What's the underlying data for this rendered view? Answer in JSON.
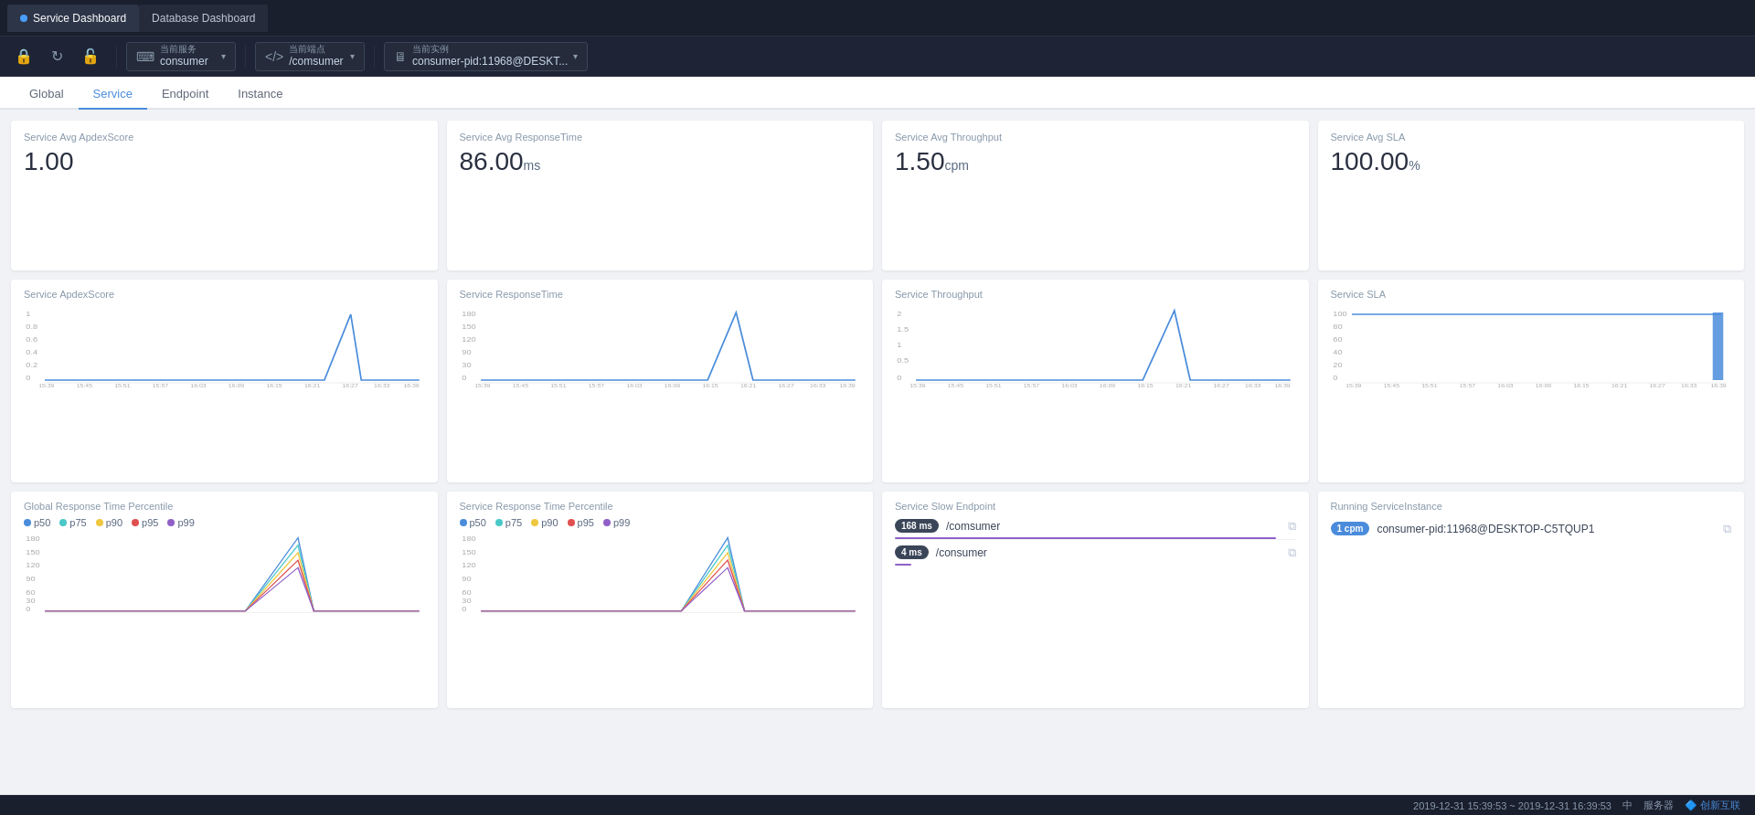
{
  "app": {
    "title": "Service Dashboard",
    "tab1": "Service Dashboard",
    "tab2": "Database Dashboard"
  },
  "toolbar": {
    "current_service_label": "当前服务",
    "current_service_value": "consumer",
    "current_endpoint_label": "当前端点",
    "current_endpoint_value": "/comsumer",
    "current_instance_label": "当前实例",
    "current_instance_value": "consumer-pid:11968@DESKT..."
  },
  "nav": {
    "tabs": [
      "Global",
      "Service",
      "Endpoint",
      "Instance"
    ],
    "active": "Service"
  },
  "metrics": {
    "apdex_label": "Service Avg ApdexScore",
    "apdex_value": "1.00",
    "response_label": "Service Avg ResponseTime",
    "response_value": "86.00",
    "response_unit": "ms",
    "throughput_label": "Service Avg Throughput",
    "throughput_value": "1.50",
    "throughput_unit": "cpm",
    "sla_label": "Service Avg SLA",
    "sla_value": "100.00",
    "sla_unit": "%"
  },
  "charts": {
    "apdex_title": "Service ApdexScore",
    "response_title": "Service ResponseTime",
    "throughput_title": "Service Throughput",
    "sla_title": "Service SLA",
    "global_percentile_title": "Global Response Time Percentile",
    "service_percentile_title": "Service Response Time Percentile"
  },
  "legend": {
    "items": [
      "p50",
      "p75",
      "p90",
      "p95",
      "p99"
    ],
    "colors": [
      "#4a8cdb",
      "#4ac8c8",
      "#f0c840",
      "#e05050",
      "#9060c8"
    ]
  },
  "time_labels": [
    "15:39\n12-31",
    "15:45\n12-31",
    "15:51\n12-31",
    "15:57\n12-31",
    "16:03\n12-31",
    "16:09\n12-31",
    "16:15\n12-31",
    "16:21\n12-31",
    "16:27\n12-31",
    "16:33\n12-31",
    "16:39\n12-31"
  ],
  "slow_endpoint": {
    "title": "Service Slow Endpoint",
    "items": [
      {
        "badge": "168 ms",
        "badge_class": "badge-dark",
        "name": "/comsumer",
        "bar_width": "95%"
      },
      {
        "badge": "4 ms",
        "badge_class": "badge-dark",
        "name": "/consumer",
        "bar_width": "4%"
      }
    ]
  },
  "running_instance": {
    "title": "Running ServiceInstance",
    "items": [
      {
        "badge": "1 cpm",
        "badge_class": "badge-blue",
        "name": "consumer-pid:11968@DESKTOP-C5TQUP1"
      }
    ]
  },
  "status_bar": {
    "time_range": "2019-12-31 15:39:53 ~ 2019-12-31 16:39:53",
    "language": "中",
    "server": "服务器",
    "brand": "创新互联"
  }
}
